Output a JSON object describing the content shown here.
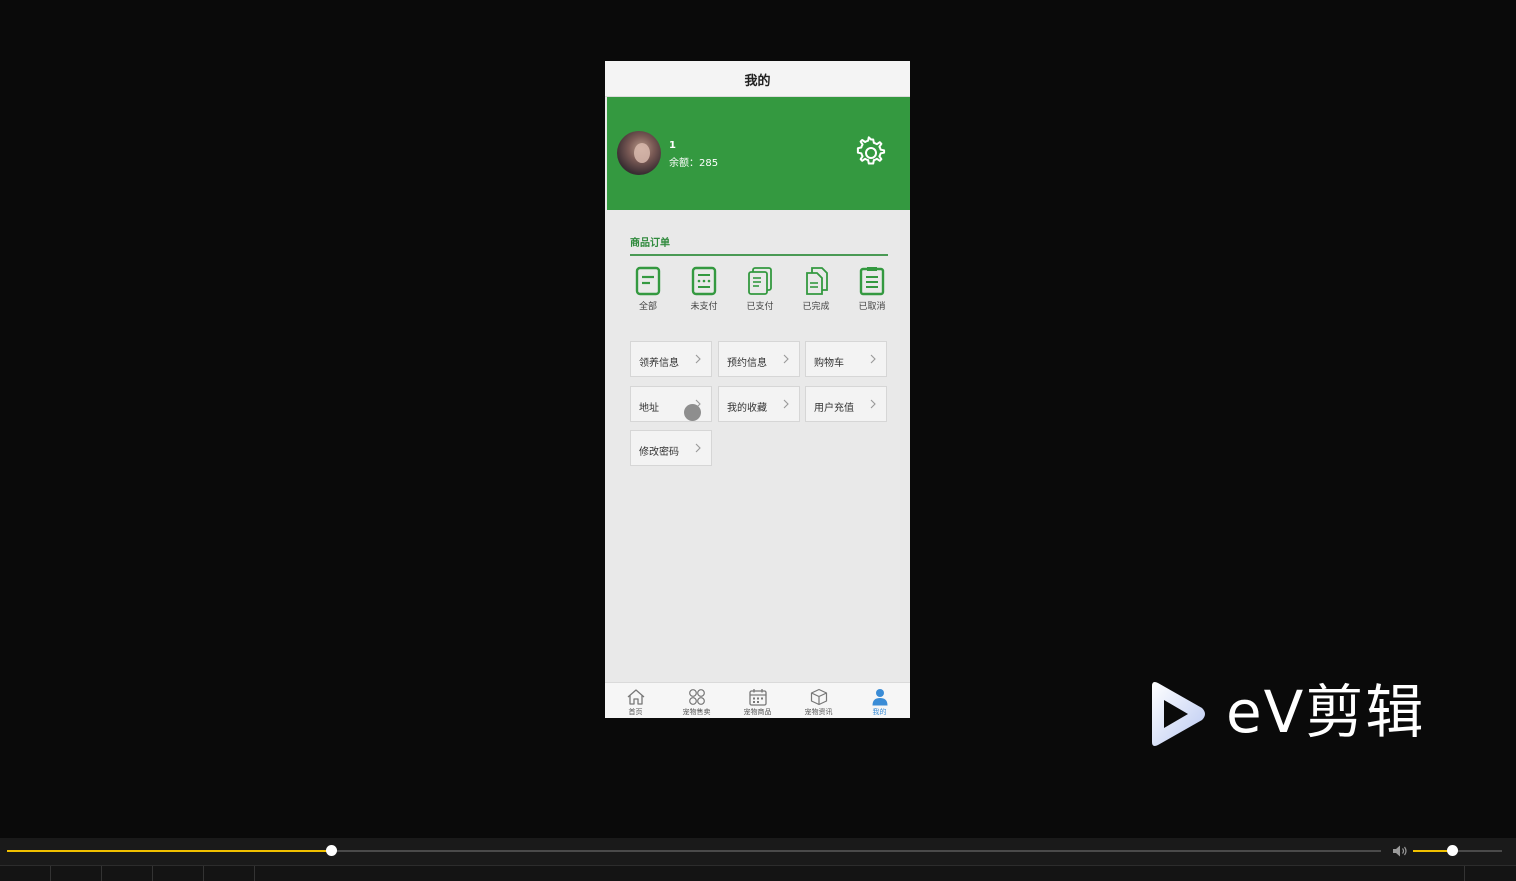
{
  "header": {
    "title": "我的"
  },
  "profile": {
    "name": "1",
    "balance_label": "余额：",
    "balance_value": "285"
  },
  "orders": {
    "title": "商品订单",
    "items": [
      {
        "label": "全部",
        "icon": "doc-icon"
      },
      {
        "label": "未支付",
        "icon": "unpaid-icon"
      },
      {
        "label": "已支付",
        "icon": "paid-icon"
      },
      {
        "label": "已完成",
        "icon": "completed-icon"
      },
      {
        "label": "已取消",
        "icon": "cancelled-icon"
      }
    ]
  },
  "menu": {
    "items": [
      {
        "label": "领养信息"
      },
      {
        "label": "预约信息"
      },
      {
        "label": "购物车"
      },
      {
        "label": "地址"
      },
      {
        "label": "我的收藏"
      },
      {
        "label": "用户充值"
      },
      {
        "label": "修改密码"
      }
    ]
  },
  "tabbar": {
    "items": [
      {
        "label": "首页",
        "icon": "home-icon"
      },
      {
        "label": "宠物售卖",
        "icon": "grid-icon"
      },
      {
        "label": "宠物商品",
        "icon": "calendar-icon"
      },
      {
        "label": "宠物资讯",
        "icon": "box-icon"
      },
      {
        "label": "我的",
        "icon": "user-icon",
        "active": true
      }
    ]
  },
  "watermark": {
    "text": "eV剪辑"
  },
  "player": {
    "progress": 0.236,
    "volume": 0.44
  },
  "colors": {
    "brand_green": "#349940",
    "accent_blue": "#3a8cd6",
    "progress_yellow": "#f0c000"
  }
}
